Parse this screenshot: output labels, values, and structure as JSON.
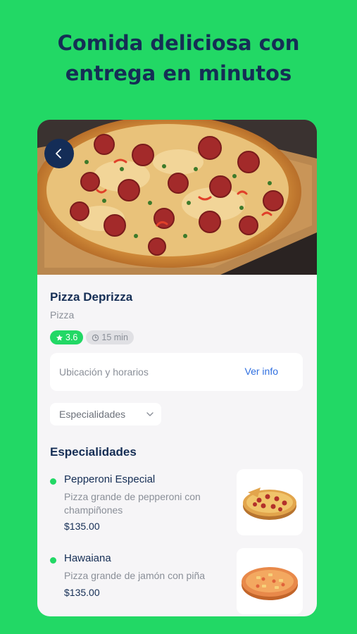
{
  "headline": {
    "line1": "Comida deliciosa con",
    "line2": "entrega en minutos"
  },
  "store": {
    "name": "Pizza Deprizza",
    "category": "Pizza",
    "rating": "3.6",
    "delivery_time": "15 min"
  },
  "info": {
    "label": "Ubicación y horarios",
    "link": "Ver info"
  },
  "category_select": {
    "value": "Especialidades"
  },
  "section_title": "Especialidades",
  "items": [
    {
      "name": "Pepperoni Especial",
      "description": "Pizza grande de pepperoni con champiñones",
      "price": "$135.00"
    },
    {
      "name": "Hawaiana",
      "description": "Pizza grande de jamón con piña",
      "price": "$135.00"
    }
  ],
  "icons": {
    "back": "chevron-left-icon",
    "rating": "star-icon",
    "time": "clock-icon",
    "select": "chevron-down-icon"
  },
  "colors": {
    "background": "#22d865",
    "navy": "#152e55",
    "link": "#2f6fe0",
    "muted": "#8a8f98"
  }
}
